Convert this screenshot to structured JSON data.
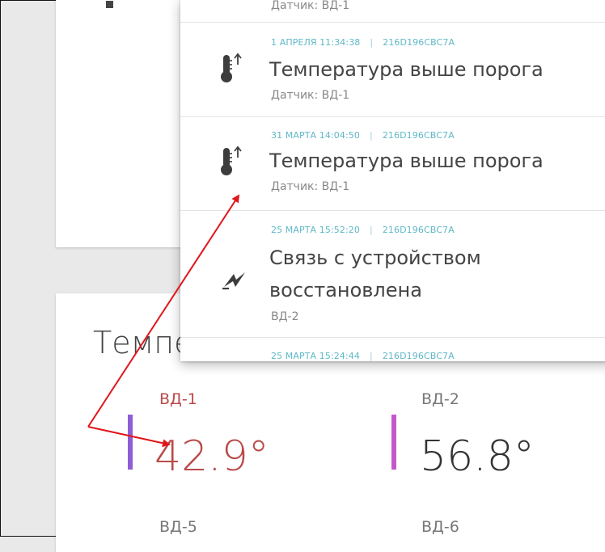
{
  "notifications": [
    {
      "sub": "Датчик: ВД-1"
    },
    {
      "datetime": "1 АПРЕЛЯ 11:34:38",
      "sep": "|",
      "device": "216D196CBC7A",
      "icon": "thermometer-up-icon",
      "message": "Температура выше порога",
      "sub": "Датчик: ВД-1"
    },
    {
      "datetime": "31 МАРТА 14:04:50",
      "sep": "|",
      "device": "216D196CBC7A",
      "icon": "thermometer-up-icon",
      "message": "Температура выше порога",
      "sub": "Датчик: ВД-1"
    },
    {
      "datetime": "25 МАРТА 15:52:20",
      "sep": "|",
      "device": "216D196CBC7A",
      "icon": "connection-restored-icon",
      "message_line1": "Связь с устройством",
      "message_line2": "восстановлена",
      "sub": "ВД-2"
    },
    {
      "datetime": "25 МАРТА 15:24:44",
      "sep": "|",
      "device": "216D196CBC7A"
    }
  ],
  "temperature_card": {
    "title": "Температура",
    "sensors": [
      {
        "name": "ВД-1",
        "value": "42.9°",
        "color": "#b94a48",
        "bar_color": "#8e5ed6"
      },
      {
        "name": "ВД-2",
        "value": "56.8°",
        "color": "#333333",
        "bar_color": "#c657c9"
      },
      {
        "name": "ВД-5"
      },
      {
        "name": "ВД-6"
      }
    ]
  },
  "annotation_color": "#e0161b"
}
